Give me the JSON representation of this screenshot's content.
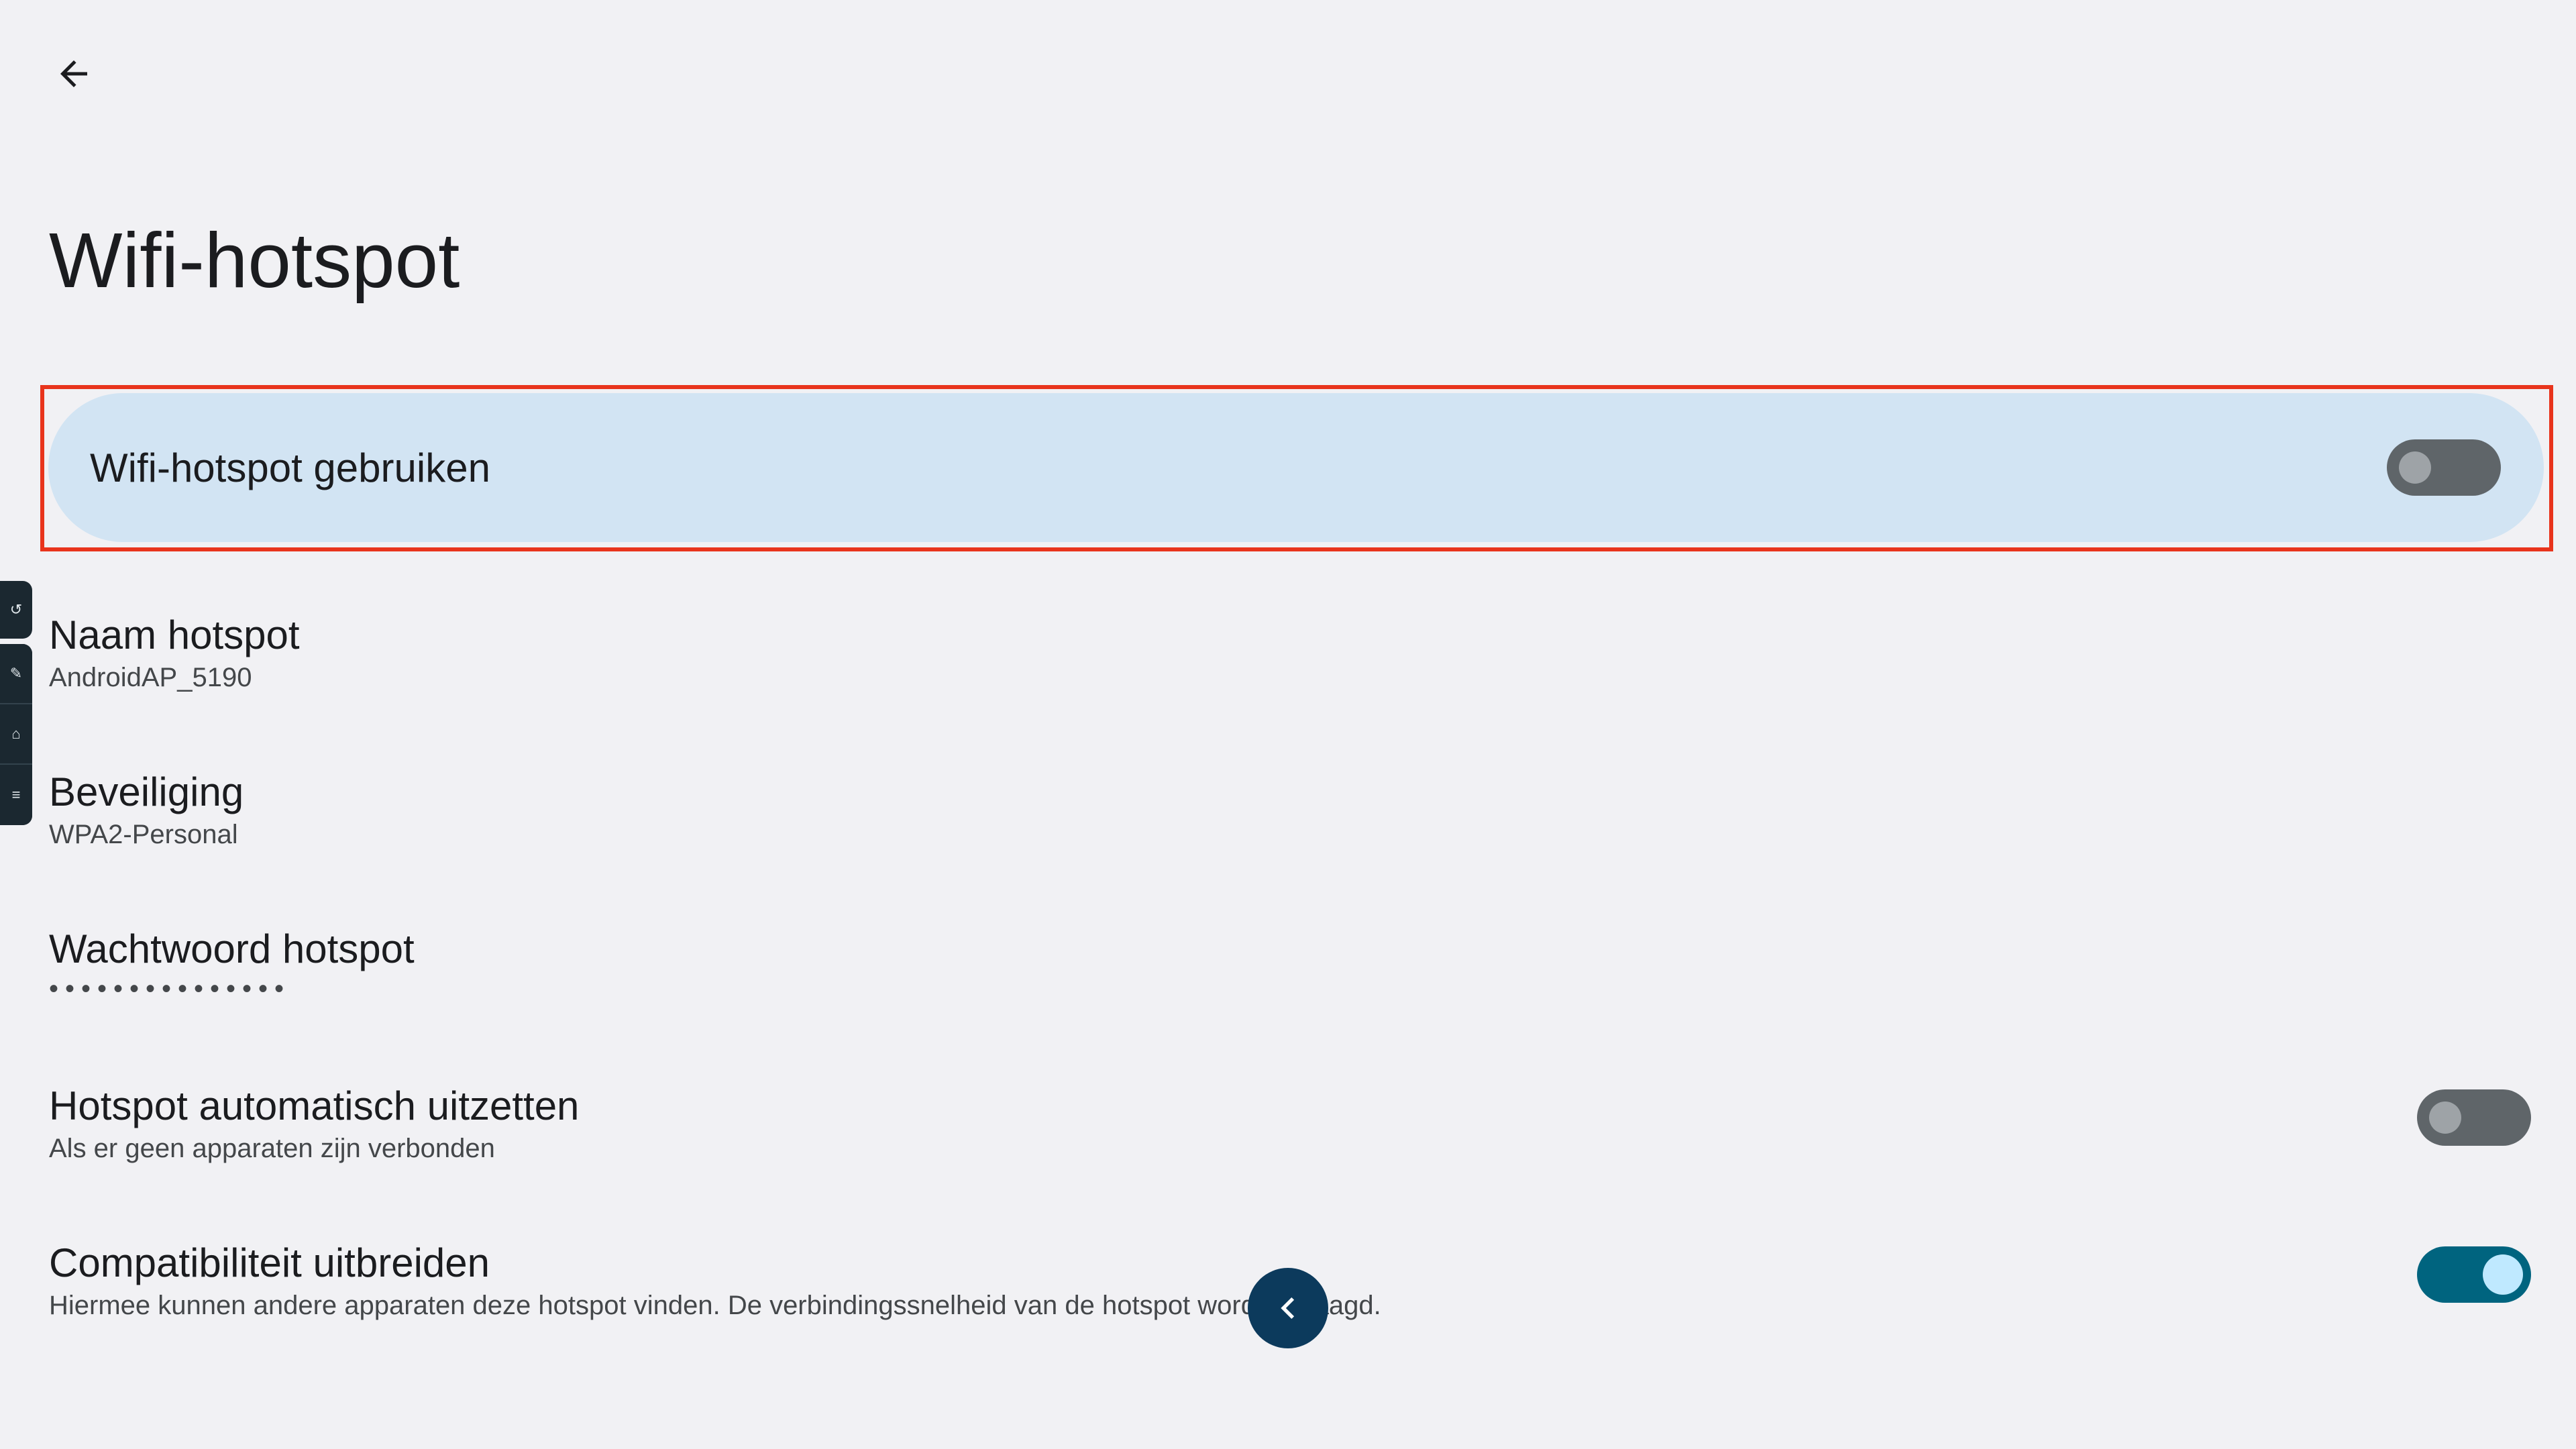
{
  "page": {
    "title": "Wifi-hotspot"
  },
  "master_switch": {
    "label": "Wifi-hotspot gebruiken",
    "checked": false
  },
  "preferences": {
    "name": {
      "title": "Naam hotspot",
      "summary": "AndroidAP_5190"
    },
    "security": {
      "title": "Beveiliging",
      "summary": "WPA2-Personal"
    },
    "password": {
      "title": "Wachtwoord hotspot",
      "masked": "•••••••••••••••"
    },
    "auto_off": {
      "title": "Hotspot automatisch uitzetten",
      "summary": "Als er geen apparaten zijn verbonden",
      "checked": false
    },
    "compatibility": {
      "title": "Compatibiliteit uitbreiden",
      "summary": "Hiermee kunnen andere apparaten deze hotspot vinden. De verbindingssnelheid van de hotspot wordt verlaagd.",
      "checked": true
    }
  },
  "side_toolbar": {
    "items": [
      {
        "icon": "rotate-icon",
        "glyph": "↺"
      },
      {
        "icon": "pin-icon",
        "glyph": "✎"
      },
      {
        "icon": "home-icon",
        "glyph": "⌂"
      },
      {
        "icon": "menu-icon",
        "glyph": "≡"
      }
    ]
  },
  "icons": {
    "back": "arrow-left-icon",
    "floating_back": "chevron-left-icon"
  },
  "colors": {
    "background": "#f1f1f4",
    "master_row": "#d2e4f3",
    "highlight_frame": "#e8341c",
    "switch_on": "#00647f",
    "switch_off": "#5f6569",
    "floating_button": "#0c3a5c"
  }
}
